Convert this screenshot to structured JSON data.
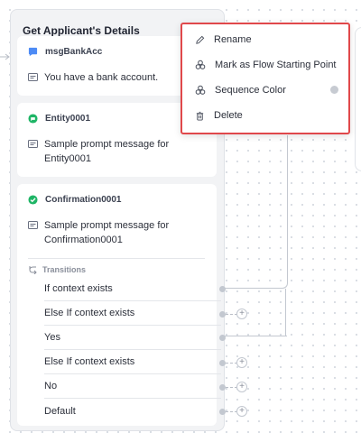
{
  "node": {
    "title": "Get Applicant's Details",
    "more_icon": "vertical-dots-icon"
  },
  "cards": [
    {
      "name": "msgBankAcc",
      "type_icon": "message-bubble-icon",
      "type_color": "#4d8bf5",
      "message_icon": "message-box-icon",
      "message": "You have a bank account."
    },
    {
      "name": "Entity0001",
      "type_icon": "entity-chat-icon",
      "type_color": "#1fb566",
      "message_icon": "message-box-icon",
      "message": "Sample prompt message for Entity0001"
    },
    {
      "name": "Confirmation0001",
      "type_icon": "check-circle-icon",
      "type_color": "#1fb566",
      "message_icon": "message-box-icon",
      "message": "Sample prompt message for Confirmation0001",
      "transitions_label": "Transitions",
      "transitions_icon": "transitions-icon",
      "transitions": [
        {
          "label": "If context exists",
          "connected": true
        },
        {
          "label": "Else If context exists",
          "connected": false
        },
        {
          "label": "Yes",
          "connected": true
        },
        {
          "label": "Else If context exists",
          "connected": false
        },
        {
          "label": "No",
          "connected": false
        },
        {
          "label": "Default",
          "connected": false
        }
      ]
    }
  ],
  "context_menu": {
    "items": [
      {
        "label": "Rename",
        "icon": "pencil-icon"
      },
      {
        "label": "Mark as Flow Starting Point",
        "icon": "flow-start-icon"
      },
      {
        "label": "Sequence Color",
        "icon": "palette-icon"
      },
      {
        "label": "Delete",
        "icon": "trash-icon"
      }
    ],
    "highlight_color": "#e0484b"
  }
}
